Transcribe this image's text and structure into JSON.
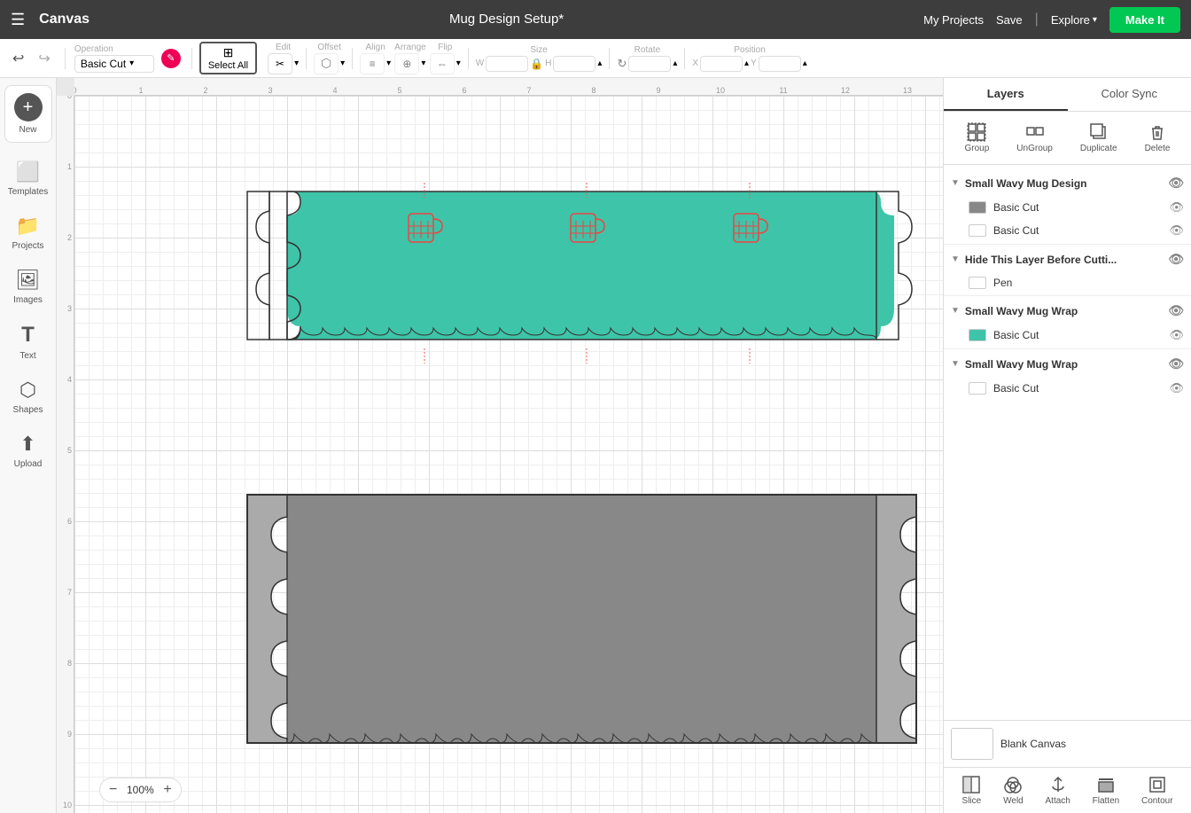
{
  "topbar": {
    "menu_label": "☰",
    "logo": "Canvas",
    "title": "Mug Design Setup*",
    "my_projects": "My Projects",
    "save": "Save",
    "divider": "|",
    "explore": "Explore",
    "make_it": "Make It"
  },
  "toolbar": {
    "operation_label": "Operation",
    "operation_value": "Basic Cut",
    "select_all": "Select All",
    "edit": "Edit",
    "offset": "Offset",
    "align": "Align",
    "arrange": "Arrange",
    "flip": "Flip",
    "size": "Size",
    "w_label": "W",
    "h_label": "H",
    "rotate": "Rotate",
    "position": "Position",
    "x_label": "X",
    "y_label": "Y"
  },
  "sidebar": {
    "items": [
      {
        "id": "new",
        "label": "New",
        "icon": "+"
      },
      {
        "id": "templates",
        "label": "Templates",
        "icon": "⬜"
      },
      {
        "id": "projects",
        "label": "Projects",
        "icon": "📁"
      },
      {
        "id": "images",
        "label": "Images",
        "icon": "🖼"
      },
      {
        "id": "text",
        "label": "Text",
        "icon": "T"
      },
      {
        "id": "shapes",
        "label": "Shapes",
        "icon": "⬡"
      },
      {
        "id": "upload",
        "label": "Upload",
        "icon": "⬆"
      }
    ]
  },
  "canvas": {
    "zoom": "100%",
    "ruler_h_marks": [
      "0",
      "1",
      "2",
      "3",
      "4",
      "5",
      "6",
      "7",
      "8",
      "9",
      "10",
      "11",
      "12",
      "13"
    ],
    "ruler_v_marks": [
      "0",
      "1",
      "2",
      "3",
      "4",
      "5",
      "6",
      "7",
      "8",
      "9",
      "10"
    ]
  },
  "right_panel": {
    "tabs": [
      {
        "id": "layers",
        "label": "Layers",
        "active": true
      },
      {
        "id": "color_sync",
        "label": "Color Sync",
        "active": false
      }
    ],
    "actions": [
      {
        "id": "group",
        "label": "Group",
        "icon": "⊞",
        "disabled": false
      },
      {
        "id": "ungroup",
        "label": "UnGroup",
        "icon": "⊟",
        "disabled": false
      },
      {
        "id": "duplicate",
        "label": "Duplicate",
        "icon": "❐",
        "disabled": false
      },
      {
        "id": "delete",
        "label": "Delete",
        "icon": "🗑",
        "disabled": false
      }
    ],
    "layers": [
      {
        "id": "small-wavy-mug-design",
        "name": "Small Wavy Mug Design",
        "expanded": true,
        "children": [
          {
            "id": "basic-cut-1",
            "name": "Basic Cut",
            "color": "#888888"
          },
          {
            "id": "basic-cut-2",
            "name": "Basic Cut",
            "color": null
          }
        ]
      },
      {
        "id": "hide-layer",
        "name": "Hide This Layer Before Cutti...",
        "expanded": true,
        "children": [
          {
            "id": "pen",
            "name": "Pen",
            "color": null
          }
        ]
      },
      {
        "id": "small-wavy-mug-wrap-1",
        "name": "Small Wavy Mug Wrap",
        "expanded": true,
        "children": [
          {
            "id": "basic-cut-3",
            "name": "Basic Cut",
            "color": "#40c4a0"
          }
        ]
      },
      {
        "id": "small-wavy-mug-wrap-2",
        "name": "Small Wavy Mug Wrap",
        "expanded": true,
        "children": [
          {
            "id": "basic-cut-4",
            "name": "Basic Cut",
            "color": null
          }
        ]
      }
    ],
    "blank_canvas": {
      "label": "Blank Canvas"
    },
    "footer_actions": [
      {
        "id": "slice",
        "label": "Slice",
        "icon": "◧"
      },
      {
        "id": "weld",
        "label": "Weld",
        "icon": "⊕"
      },
      {
        "id": "attach",
        "label": "Attach",
        "icon": "📎"
      },
      {
        "id": "flatten",
        "label": "Flatten",
        "icon": "⬛"
      },
      {
        "id": "contour",
        "label": "Contour",
        "icon": "◎"
      }
    ]
  }
}
